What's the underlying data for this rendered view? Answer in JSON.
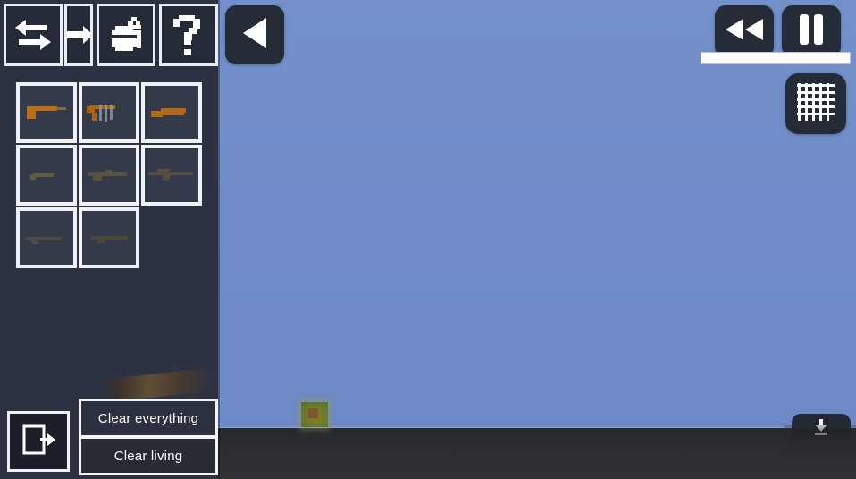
{
  "app": {
    "title": "Sandbox Weapon Spawner",
    "sky_color": "#6f8cc8",
    "ground_color": "#2a2c30",
    "panel_color": "#2c3242",
    "accent_color": "#eef1f6"
  },
  "sidebar": {
    "toolbar": [
      {
        "id": "swap",
        "icon": "swap-arrows-icon",
        "label": "Swap"
      },
      {
        "id": "spawn-arrow",
        "icon": "arrow-right-icon",
        "label": "Spawn"
      },
      {
        "id": "paint",
        "icon": "paint-bucket-icon",
        "label": "Paint"
      },
      {
        "id": "help",
        "icon": "question-mark-icon",
        "label": "Help"
      }
    ],
    "weapons": [
      {
        "slot": 1,
        "name": "Pistol",
        "tint": "#c8700f"
      },
      {
        "slot": 2,
        "name": "Machine Gun",
        "tint": "#b5670f"
      },
      {
        "slot": 3,
        "name": "Sawed-off Shotgun",
        "tint": "#c06a10"
      },
      {
        "slot": 4,
        "name": "Revolver",
        "tint": "#6a5a42"
      },
      {
        "slot": 5,
        "name": "Assault Rifle",
        "tint": "#5d5340"
      },
      {
        "slot": 6,
        "name": "Sniper Rifle",
        "tint": "#57503f"
      },
      {
        "slot": 7,
        "name": "Submachine Gun",
        "tint": "#514b3c"
      },
      {
        "slot": 8,
        "name": "Battle Rifle",
        "tint": "#4e483a"
      }
    ],
    "exit": {
      "icon": "exit-door-icon",
      "label": "Exit"
    },
    "clear_buttons": [
      {
        "id": "clear-everything",
        "label": "Clear everything"
      },
      {
        "id": "clear-living",
        "label": "Clear living"
      }
    ]
  },
  "overlay": {
    "collapse": {
      "icon": "triangle-left-icon",
      "label": "Collapse panel"
    },
    "rewind": {
      "icon": "rewind-icon",
      "label": "Rewind"
    },
    "pause": {
      "icon": "pause-icon",
      "label": "Pause"
    },
    "timeline": {
      "label": "Timeline",
      "progress": 100
    },
    "grid": {
      "icon": "grid-icon",
      "label": "Toggle grid"
    },
    "download": {
      "icon": "download-icon",
      "label": "Download"
    }
  },
  "world": {
    "entity": {
      "name": "spawned-block",
      "label": "Block entity"
    }
  }
}
